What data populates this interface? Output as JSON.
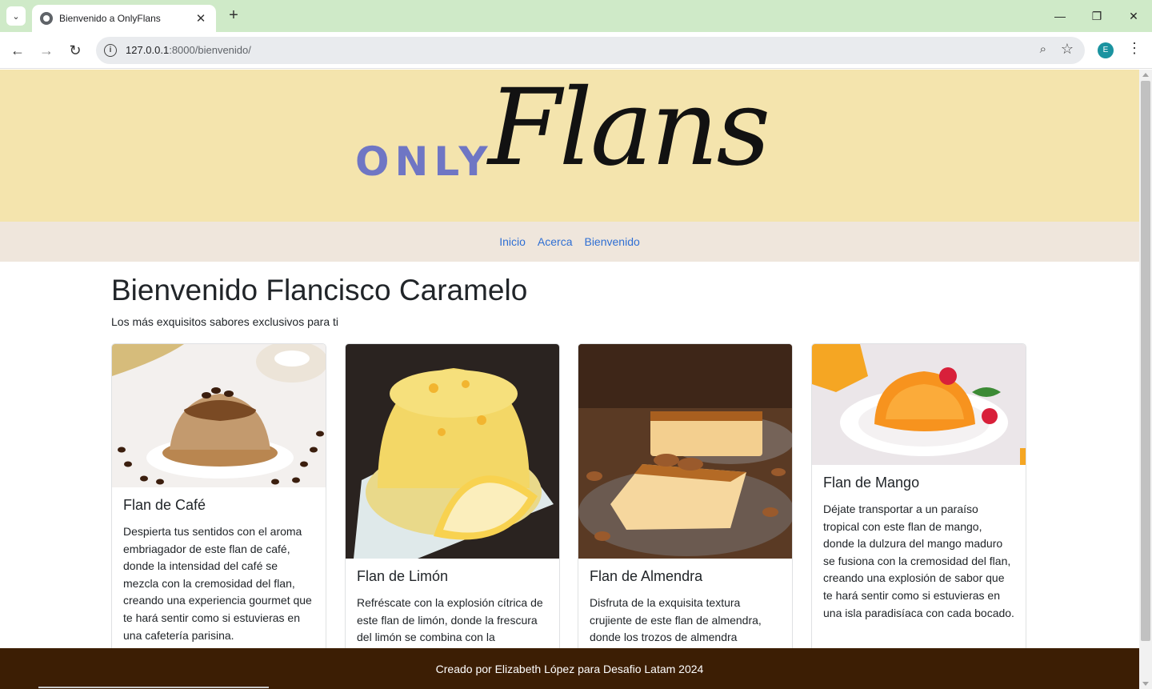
{
  "browser": {
    "tab_title": "Bienvenido a OnlyFlans",
    "url_host": "127.0.0.1",
    "url_path": ":8000/bienvenido/",
    "profile_initial": "E"
  },
  "logo": {
    "part1": "ONLY",
    "part2": "Flans"
  },
  "nav": {
    "inicio": "Inicio",
    "acerca": "Acerca",
    "bienvenido": "Bienvenido"
  },
  "page": {
    "title": "Bienvenido Flancisco Caramelo",
    "subtitle": "Los más exquisitos sabores exclusivos para ti"
  },
  "cards": [
    {
      "title": "Flan de Café",
      "text": "Despierta tus sentidos con el aroma embriagador de este flan de café, donde la intensidad del café se mezcla con la cremosidad del flan, creando una experiencia gourmet que te hará sentir como si estuvieras en una cafetería parisina."
    },
    {
      "title": "Flan de Limón",
      "text": "Refréscate con la explosión cítrica de este flan de limón, donde la frescura del limón se combina con la"
    },
    {
      "title": "Flan de Almendra",
      "text": "Disfruta de la exquisita textura crujiente de este flan de almendra, donde los trozos de almendra"
    },
    {
      "title": "Flan de Mango",
      "text": "Déjate transportar a un paraíso tropical con este flan de mango, donde la dulzura del mango maduro se fusiona con la cremosidad del flan, creando una explosión de sabor que te hará sentir como si estuvieras en una isla paradisíaca con cada bocado."
    }
  ],
  "footer": {
    "text": "Creado por Elizabeth López para Desafio Latam 2024"
  },
  "colors": {
    "hero_bg": "#f4e4ad",
    "nav_bg": "#efe6dc",
    "link": "#2f6fd3",
    "footer_bg": "#3c1e04",
    "logo_only": "#6f76c4"
  }
}
